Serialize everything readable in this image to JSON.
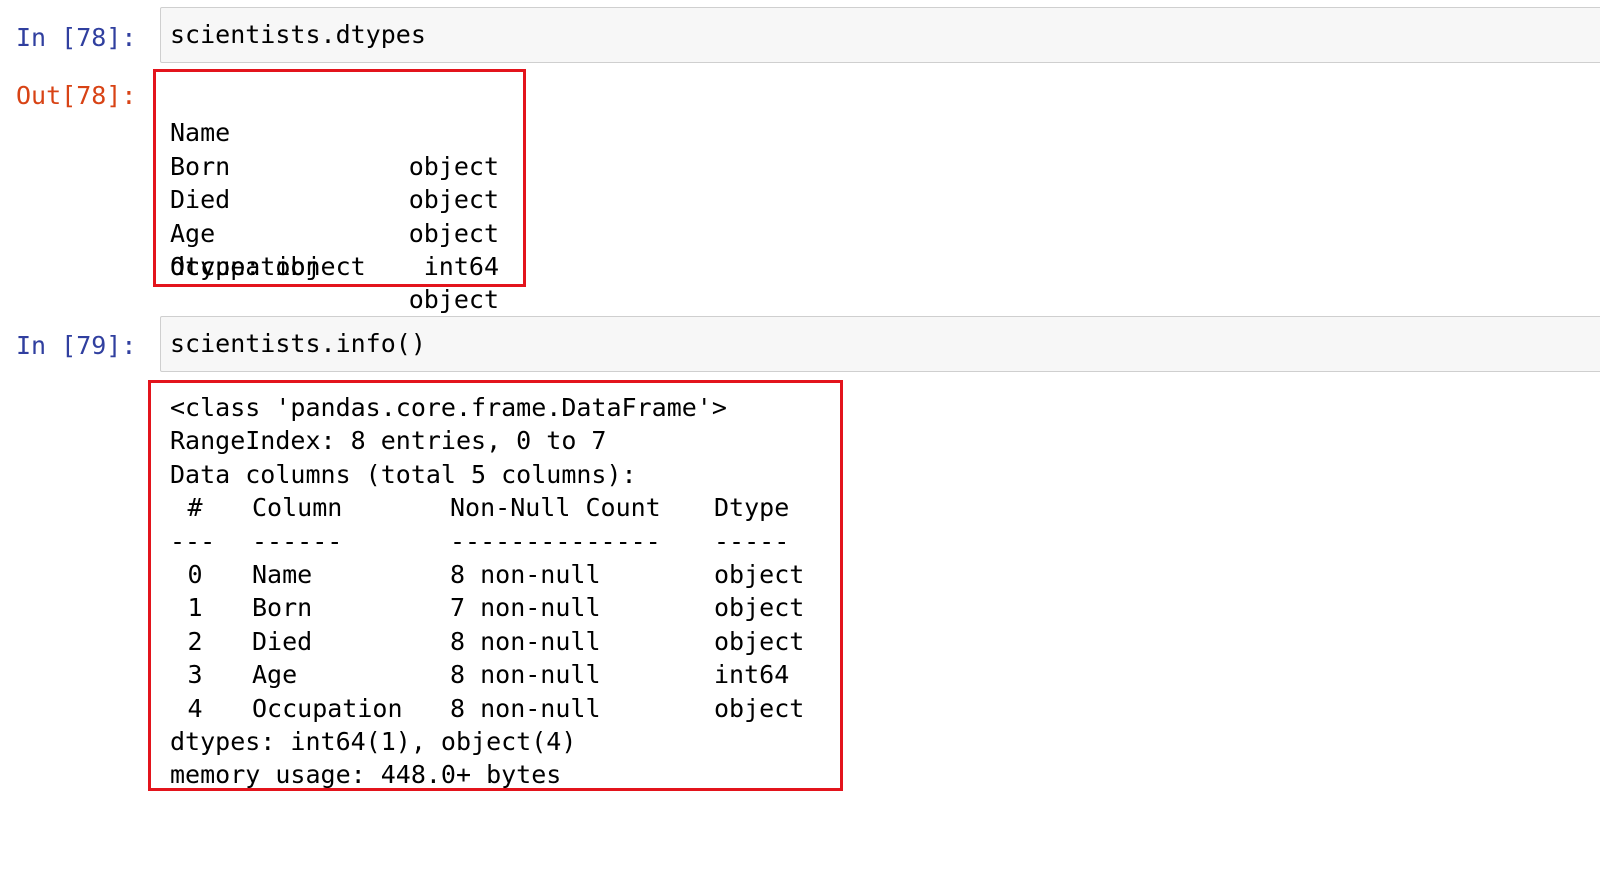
{
  "cells": [
    {
      "in_prompt": "In [78]:",
      "code": "scientists.dtypes",
      "out_prompt": "Out[78]:",
      "dtypes": [
        {
          "name": "Name",
          "type": "object"
        },
        {
          "name": "Born",
          "type": "object"
        },
        {
          "name": "Died",
          "type": "object"
        },
        {
          "name": "Age",
          "type": "int64"
        },
        {
          "name": "Occupation",
          "type": "object"
        }
      ],
      "footer": "dtype: object"
    },
    {
      "in_prompt": "In [79]:",
      "code": "scientists.info()",
      "info": {
        "class_line": "<class 'pandas.core.frame.DataFrame'>",
        "range_line": "RangeIndex: 8 entries, 0 to 7",
        "columns_line": "Data columns (total 5 columns):",
        "headers": [
          "#",
          "Column",
          "Non-Null Count",
          "Dtype"
        ],
        "separators": [
          "---",
          "------",
          "--------------",
          "-----"
        ],
        "rows": [
          [
            "0",
            "Name",
            "8 non-null",
            "object"
          ],
          [
            "1",
            "Born",
            "7 non-null",
            "object"
          ],
          [
            "2",
            "Died",
            "8 non-null",
            "object"
          ],
          [
            "3",
            "Age",
            "8 non-null",
            "int64"
          ],
          [
            "4",
            "Occupation",
            "8 non-null",
            "object"
          ]
        ],
        "dtypes_line": "dtypes: int64(1), object(4)",
        "memory_line": "memory usage: 448.0+ bytes"
      }
    }
  ],
  "colors": {
    "in_prompt": "#303f9f",
    "out_prompt": "#d84315",
    "highlight_box": "#e3141c",
    "input_bg": "#f7f7f7"
  }
}
